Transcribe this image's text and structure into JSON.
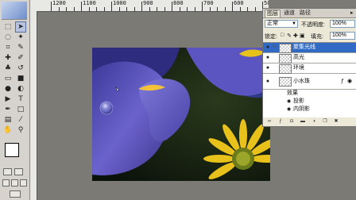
{
  "colors": {
    "workspace": "#7b7a74",
    "panel_bg": "#ece9d8",
    "selection": "#316ac5",
    "petal": "#5a4fb8",
    "sunflower": "#e8c21a"
  },
  "ruler": {
    "labels": [
      "1200",
      "1100",
      "1000",
      "900",
      "800",
      "700",
      "600",
      "500"
    ]
  },
  "toolbox": {
    "tools": [
      {
        "icon": "marquee-icon",
        "glyph": "⬚"
      },
      {
        "icon": "move-icon",
        "glyph": "➤"
      },
      {
        "icon": "lasso-icon",
        "glyph": "◌"
      },
      {
        "icon": "magic-wand-icon",
        "glyph": "✦"
      },
      {
        "icon": "crop-icon",
        "glyph": "⌗"
      },
      {
        "icon": "slice-icon",
        "glyph": "✎"
      },
      {
        "icon": "healing-brush-icon",
        "glyph": "✚"
      },
      {
        "icon": "brush-icon",
        "glyph": "✐"
      },
      {
        "icon": "clone-stamp-icon",
        "glyph": "♣"
      },
      {
        "icon": "history-brush-icon",
        "glyph": "↺"
      },
      {
        "icon": "eraser-icon",
        "glyph": "▭"
      },
      {
        "icon": "gradient-icon",
        "glyph": "■"
      },
      {
        "icon": "blur-icon",
        "glyph": "●"
      },
      {
        "icon": "dodge-icon",
        "glyph": "◐"
      },
      {
        "icon": "path-select-icon",
        "glyph": "▶"
      },
      {
        "icon": "type-icon",
        "glyph": "T"
      },
      {
        "icon": "pen-icon",
        "glyph": "✒"
      },
      {
        "icon": "shape-icon",
        "glyph": "□"
      },
      {
        "icon": "notes-icon",
        "glyph": "▤"
      },
      {
        "icon": "eyedropper-icon",
        "glyph": "⁄"
      },
      {
        "icon": "hand-icon",
        "glyph": "✋"
      },
      {
        "icon": "zoom-icon",
        "glyph": "⚲"
      }
    ]
  },
  "layers_panel": {
    "tabs": [
      "图层",
      "通道",
      "路径"
    ],
    "blend_mode": "正常",
    "opacity_label": "不透明度:",
    "opacity_value": "100%",
    "lock_label": "锁定:",
    "fill_label": "填充:",
    "fill_value": "100%",
    "layers": [
      {
        "name": "聚集光线",
        "selected": true
      },
      {
        "name": "高光",
        "selected": false
      },
      {
        "name": "环境",
        "selected": false
      },
      {
        "name": "小水珠",
        "selected": false
      }
    ],
    "effects_label": "效果",
    "effects": [
      "投影",
      "内阴影"
    ]
  }
}
